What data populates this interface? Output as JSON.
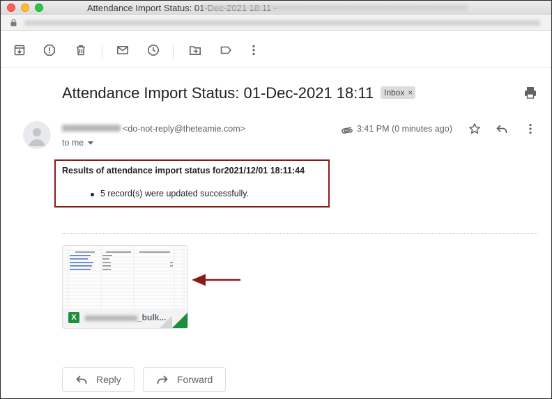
{
  "window": {
    "title": "Attendance Import Status: 01-Dec-2021 18:11 -"
  },
  "toolbar": {
    "icons": [
      "archive-icon",
      "report-spam-icon",
      "delete-icon",
      "mark-unread-icon",
      "snooze-icon",
      "move-to-icon",
      "label-icon",
      "more-vert-icon"
    ]
  },
  "email": {
    "subject": "Attendance Import Status: 01-Dec-2021 18:11",
    "label_chip": "Inbox",
    "chip_close": "×",
    "sender_email": "<do-not-reply@theteamie.com>",
    "recipient": "to me",
    "time": "3:41 PM (0 minutes ago)",
    "body_title": "Results of attendance import status for2021/12/01 18:11:44",
    "body_items": [
      "5 record(s) were updated successfully."
    ]
  },
  "attachment": {
    "file_type_letter": "X",
    "name_suffix": "_bulk...",
    "type": "spreadsheet"
  },
  "actions": {
    "reply_label": "Reply",
    "forward_label": "Forward"
  },
  "colors": {
    "highlight_border": "#8a1b1b",
    "arrow": "#8a1b1b",
    "excel_green": "#1e8e3e"
  }
}
